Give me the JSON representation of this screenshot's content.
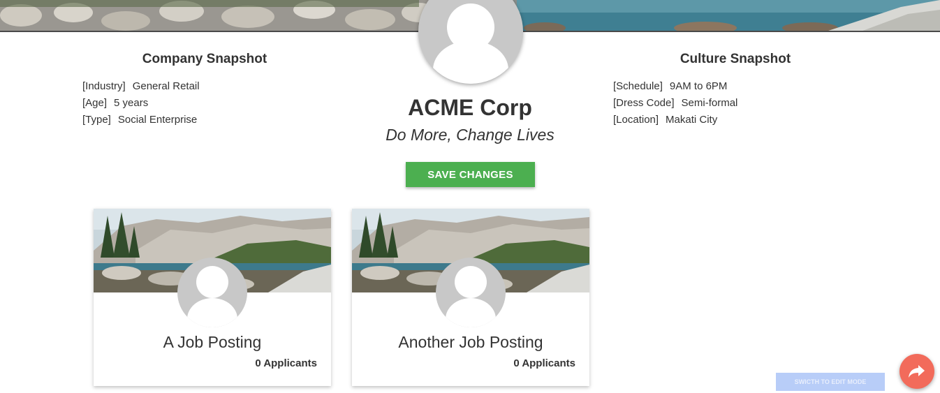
{
  "company": {
    "name": "ACME Corp",
    "tagline": "Do More, Change Lives"
  },
  "company_snapshot": {
    "title": "Company Snapshot",
    "items": [
      {
        "key": "[Industry]",
        "value": "General Retail"
      },
      {
        "key": "[Age]",
        "value": "5 years"
      },
      {
        "key": "[Type]",
        "value": "Social Enterprise"
      }
    ]
  },
  "culture_snapshot": {
    "title": "Culture Snapshot",
    "items": [
      {
        "key": "[Schedule]",
        "value": "9AM to 6PM"
      },
      {
        "key": "[Dress Code]",
        "value": "Semi-formal"
      },
      {
        "key": "[Location]",
        "value": "Makati City"
      }
    ]
  },
  "actions": {
    "save_label": "SAVE CHANGES",
    "edit_mode_label": "SWICTH TO EDIT MODE"
  },
  "jobs": [
    {
      "title": "A Job Posting",
      "applicants": "0 Applicants"
    },
    {
      "title": "Another Job Posting",
      "applicants": "0 Applicants"
    }
  ],
  "icons": {
    "share": "share-arrow-icon",
    "avatar": "person-silhouette-icon"
  },
  "colors": {
    "save_button": "#4caf50",
    "share_fab": "#f26b5b",
    "edit_mode_button": "#b8cdf8",
    "avatar_bg": "#c8c8c8"
  }
}
